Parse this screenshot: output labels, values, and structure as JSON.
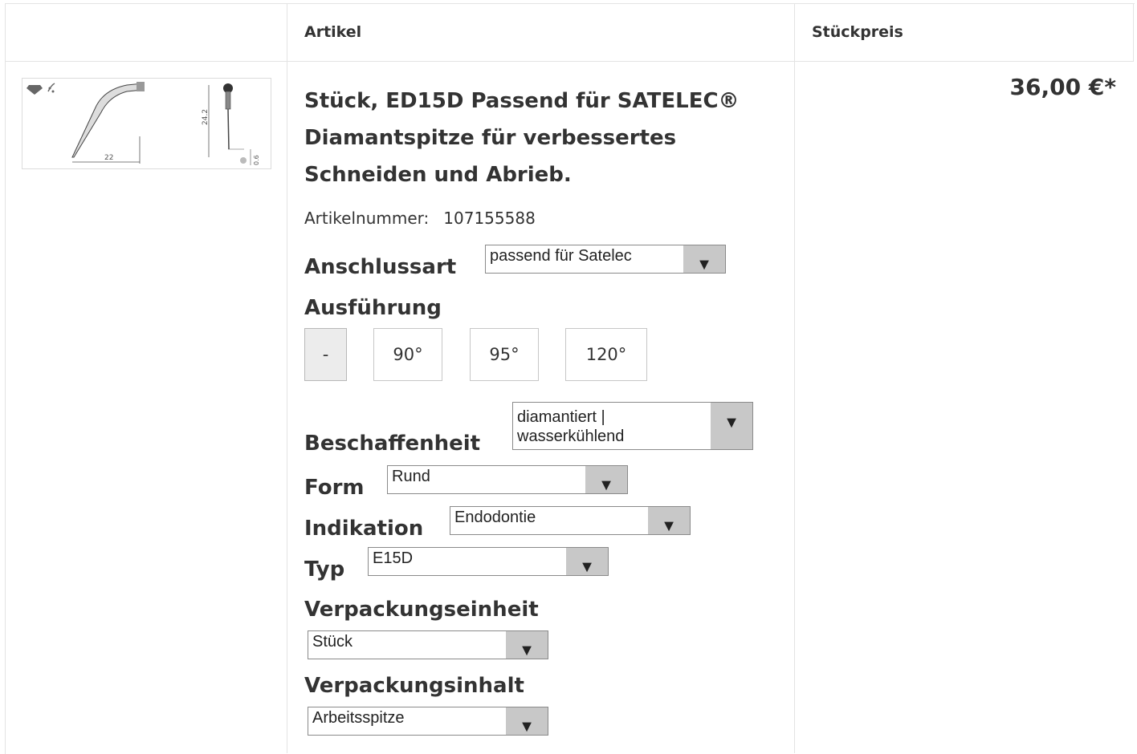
{
  "table": {
    "headers": {
      "article": "Artikel",
      "unit_price": "Stückpreis"
    }
  },
  "product": {
    "title": "Stück, ED15D Passend für SATELEC® Diamantspitze für verbessertes Schneiden und Abrieb.",
    "article_number_label": "Artikelnummer:",
    "article_number": "107155588",
    "price": "36,00 €*",
    "image": {
      "dim_length": "22",
      "dim_height": "24.2",
      "dim_tip": "0.6"
    }
  },
  "options": {
    "anschlussart": {
      "label": "Anschlussart",
      "value": "passend für Satelec"
    },
    "ausfuehrung": {
      "label": "Ausführung",
      "choices": [
        "-",
        "90°",
        "95°",
        "120°"
      ],
      "selected": "-"
    },
    "beschaffenheit": {
      "label": "Beschaffenheit",
      "value_line1": "diamantiert |",
      "value_line2": "wasserkühlend"
    },
    "form": {
      "label": "Form",
      "value": "Rund"
    },
    "indikation": {
      "label": "Indikation",
      "value": "Endodontie"
    },
    "typ": {
      "label": "Typ",
      "value": "E15D"
    },
    "verpackungseinheit": {
      "label": "Verpackungseinheit",
      "value": "Stück"
    },
    "verpackungsinhalt": {
      "label": "Verpackungsinhalt",
      "value": "Arbeitsspitze"
    }
  },
  "icons": {
    "dropdown": "triangle-down-icon",
    "diamond": "diamond-icon",
    "water": "water-cooling-icon"
  },
  "colors": {
    "border": "#e3e3e3",
    "select_arrow_bg": "#c8c8c8",
    "text": "#333333"
  }
}
